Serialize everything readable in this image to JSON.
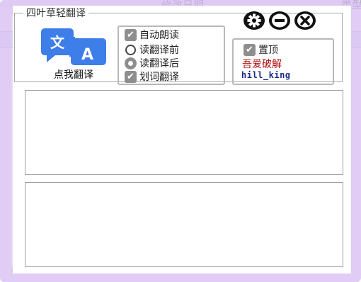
{
  "background_window": {
    "column_modify_date": "修改日期",
    "column_type": "类型"
  },
  "app": {
    "group_title": "四叶草轻翻译",
    "translate_label": "点我翻译"
  },
  "options": [
    {
      "label": "自动朗读",
      "control": "checkbox",
      "checked": true
    },
    {
      "label": "读翻译前",
      "control": "radio",
      "checked": false
    },
    {
      "label": "读翻译后",
      "control": "radio",
      "checked": true
    },
    {
      "label": "划词翻译",
      "control": "checkbox",
      "checked": true
    }
  ],
  "pin": {
    "label": "置顶",
    "checked": true
  },
  "brand": "吾爱破解",
  "author": "hill_king",
  "window_buttons": [
    "settings-icon",
    "minimize-icon",
    "close-icon"
  ],
  "source_text": {
    "value": ""
  },
  "result_text": {
    "value": ""
  },
  "colors": {
    "glow": "#d6bbf0",
    "brand": "#b01010",
    "author": "#1a2a8a",
    "icon_blue": "#3d7ee8"
  }
}
